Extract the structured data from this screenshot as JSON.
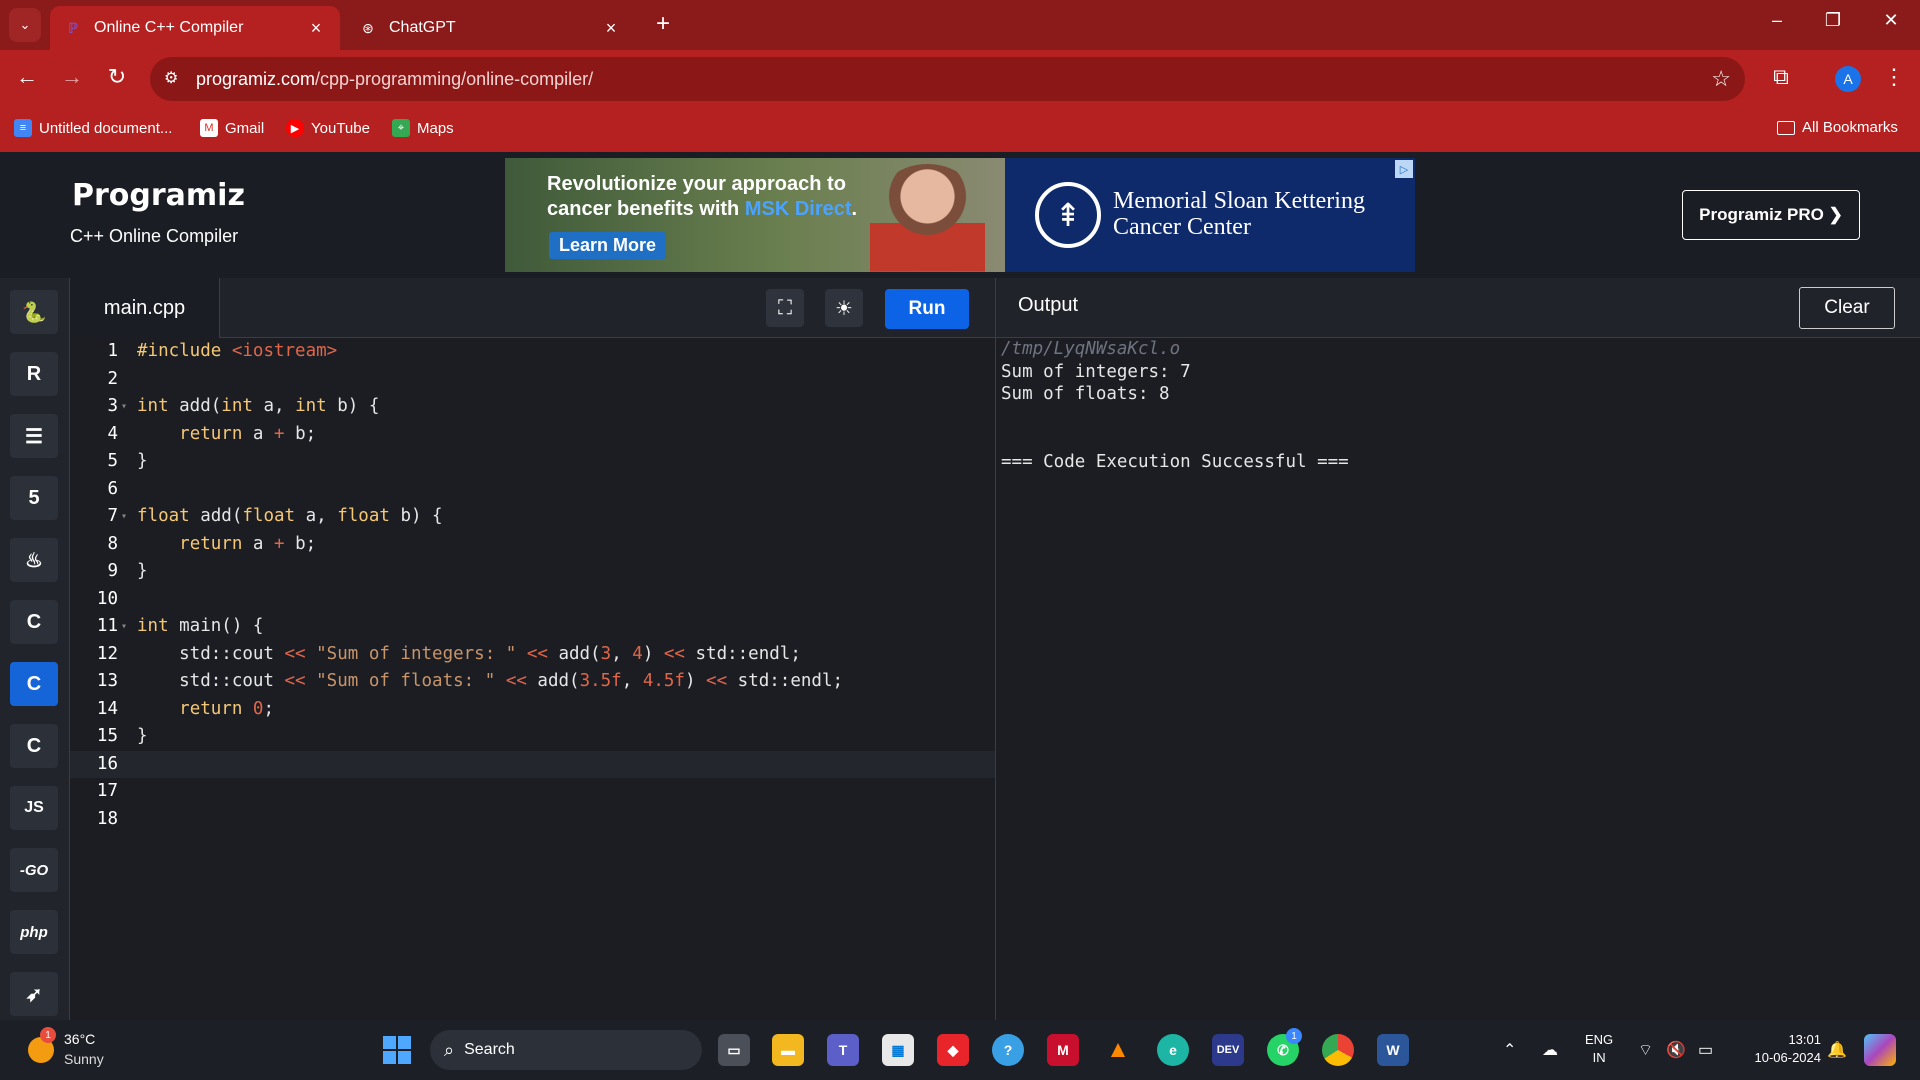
{
  "browser": {
    "tabs": [
      {
        "title": "Online C++ Compiler",
        "active": true
      },
      {
        "title": "ChatGPT",
        "active": false
      }
    ],
    "url_host": "programiz.com",
    "url_path": "/cpp-programming/online-compiler/",
    "profile_initial": "A",
    "bookmarks": [
      "Untitled document...",
      "Gmail",
      "YouTube",
      "Maps"
    ],
    "all_bookmarks": "All Bookmarks"
  },
  "site": {
    "logo": "Programiz",
    "subtitle": "C++ Online Compiler",
    "pro_button": "Programiz PRO ❯"
  },
  "ad": {
    "line1": "Revolutionize your approach to",
    "line2_prefix": "cancer benefits with ",
    "line2_highlight": "MSK Direct",
    "line2_suffix": ".",
    "cta": "Learn More",
    "org_line1": "Memorial Sloan Kettering",
    "org_line2": "Cancer Center"
  },
  "sidebar": {
    "languages": [
      "python",
      "r",
      "sql",
      "html",
      "java",
      "c",
      "cpp",
      "csharp",
      "js",
      "go",
      "php",
      "swift"
    ],
    "labels": {
      "js": "JS",
      "go": "-GO",
      "php": "php"
    },
    "active": "cpp"
  },
  "editor": {
    "filename": "main.cpp",
    "run_label": "Run",
    "current_line": 16,
    "line_numbers": [
      "1",
      "2",
      "3",
      "4",
      "5",
      "6",
      "7",
      "8",
      "9",
      "10",
      "11",
      "12",
      "13",
      "14",
      "15",
      "16",
      "17",
      "18"
    ],
    "lines": [
      "#include <iostream>",
      "",
      "int add(int a, int b) {",
      "    return a + b;",
      "}",
      "",
      "float add(float a, float b) {",
      "    return a + b;",
      "}",
      "",
      "int main() {",
      "    std::cout << \"Sum of integers: \" << add(3, 4) << std::endl;",
      "    std::cout << \"Sum of floats: \" << add(3.5f, 4.5f) << std::endl;",
      "    return 0;",
      "}",
      "",
      "",
      ""
    ]
  },
  "output": {
    "title": "Output",
    "clear_label": "Clear",
    "lines": [
      "/tmp/LyqNWsaKcl.o",
      "Sum of integers: 7",
      "Sum of floats: 8",
      "",
      "",
      "=== Code Execution Successful ==="
    ]
  },
  "taskbar": {
    "weather_temp": "36°C",
    "weather_cond": "Sunny",
    "weather_badge": "1",
    "search_label": "Search",
    "lang_top": "ENG",
    "lang_bottom": "IN",
    "time": "13:01",
    "date": "10-06-2024",
    "whatsapp_badge": "1"
  },
  "colors": {
    "chrome_accent": "#b52020",
    "run_button": "#0d63e6",
    "keyword": "#f5c875",
    "string": "#c8956b",
    "number": "#e0664a"
  }
}
